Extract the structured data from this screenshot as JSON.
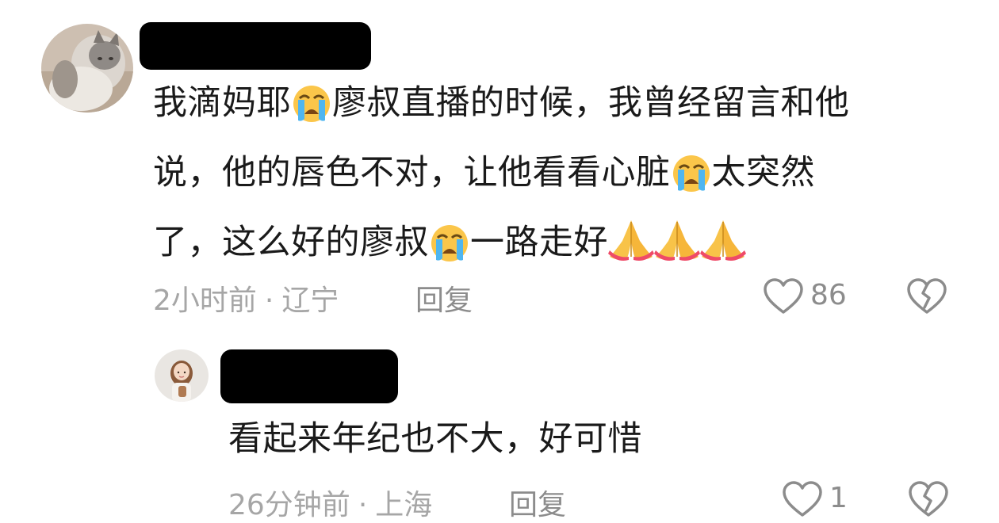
{
  "comments": [
    {
      "text_line1_a": "我滴妈耶",
      "emoji_cry": "loudly-crying-face-emoji",
      "text_line1_b": "廖叔直播的时候，我曾经留言和他",
      "text_line2_a": "说，他的唇色不对，让他看看心脏",
      "text_line2_b": "太突然",
      "text_line3_a": "了，这么好的廖叔",
      "text_line3_b": "一路走好",
      "emoji_pray": "folded-hands-emoji",
      "time": "2小时前",
      "separator": "·",
      "location": "辽宁",
      "reply_label": "回复",
      "like_count": "86",
      "like_icon": "heart-outline-icon",
      "dislike_icon": "broken-heart-icon"
    },
    {
      "text": "看起来年纪也不大，好可惜",
      "time": "26分钟前",
      "separator": "·",
      "location": "上海",
      "reply_label": "回复",
      "like_count": "1",
      "like_icon": "heart-outline-icon",
      "dislike_icon": "broken-heart-icon"
    }
  ],
  "colors": {
    "text": "#1a1a1a",
    "meta": "#a6a6a6",
    "icon": "#8c8c8c",
    "redaction": "#000000"
  }
}
